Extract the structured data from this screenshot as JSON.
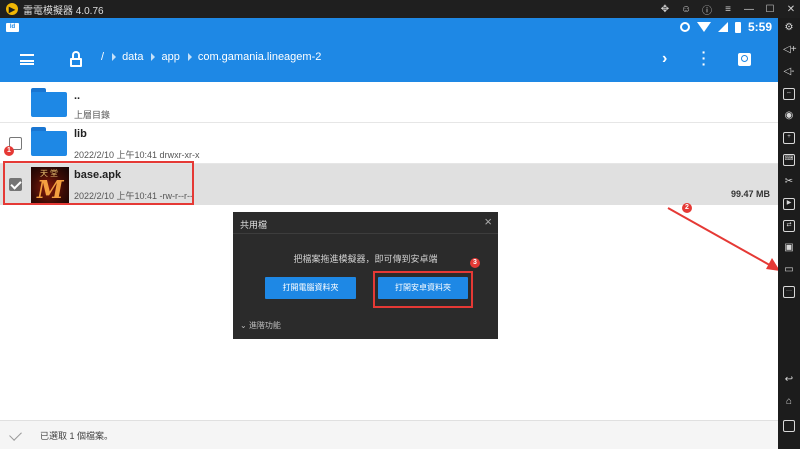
{
  "emulator": {
    "title": "雷電模擬器 4.0.76",
    "logo_icon": "ldplayer-logo-icon",
    "title_icons": [
      "gamepad-icon",
      "smiley-icon",
      "info-icon",
      "menu-icon",
      "minimize-icon",
      "maximize-icon",
      "close-icon"
    ]
  },
  "status_bar": {
    "time": "5:59",
    "icons": [
      "settings-icon",
      "wifi-icon",
      "signal-icon",
      "battery-icon"
    ]
  },
  "app_bar": {
    "breadcrumbs": [
      "/",
      "data",
      "app",
      "com.gamania.lineagem-2"
    ],
    "icons": [
      "menu-icon",
      "lock-icon",
      "chevron-right-icon",
      "more-vert-icon",
      "search-icon"
    ]
  },
  "files": [
    {
      "name": "..",
      "meta": "上層目錄",
      "size": "",
      "type": "folder",
      "checkbox": false,
      "selected": false
    },
    {
      "name": "lib",
      "meta": "2022/2/10 上午10:41   drwxr-xr-x",
      "size": "",
      "type": "folder",
      "checkbox": true,
      "selected": false
    },
    {
      "name": "base.apk",
      "meta": "2022/2/10 上午10:41   -rw-r--r--",
      "size": "99.47 MB",
      "type": "apk",
      "checkbox": true,
      "selected": true
    }
  ],
  "thumb_text": {
    "big": "M",
    "small": "天堂"
  },
  "dialog": {
    "title": "共用檔",
    "message": "把檔案拖進模擬器，即可傳到安卓端",
    "btn_pc": "打開電腦資料夾",
    "btn_android": "打開安卓資料夾",
    "advanced": "進階功能"
  },
  "annotations": {
    "badge1": "1",
    "badge2": "2",
    "badge3": "3",
    "color": "#e53935"
  },
  "bottom_bar": {
    "text": "已選取 1 個檔案。"
  },
  "sidebar_icons": [
    "settings-icon",
    "volume-up-icon",
    "volume-down-icon",
    "resize-icon",
    "record-icon",
    "add-apk-icon",
    "keyboard-icon",
    "scissors-icon",
    "video-icon",
    "sync-icon",
    "cpu-icon",
    "folder-icon",
    "more-icon",
    "back-icon",
    "home-icon",
    "recent-apps-icon"
  ],
  "colors": {
    "primary": "#1e88e5",
    "selected_row": "#e0e0e0",
    "dialog_bg": "#2b2b2b"
  }
}
